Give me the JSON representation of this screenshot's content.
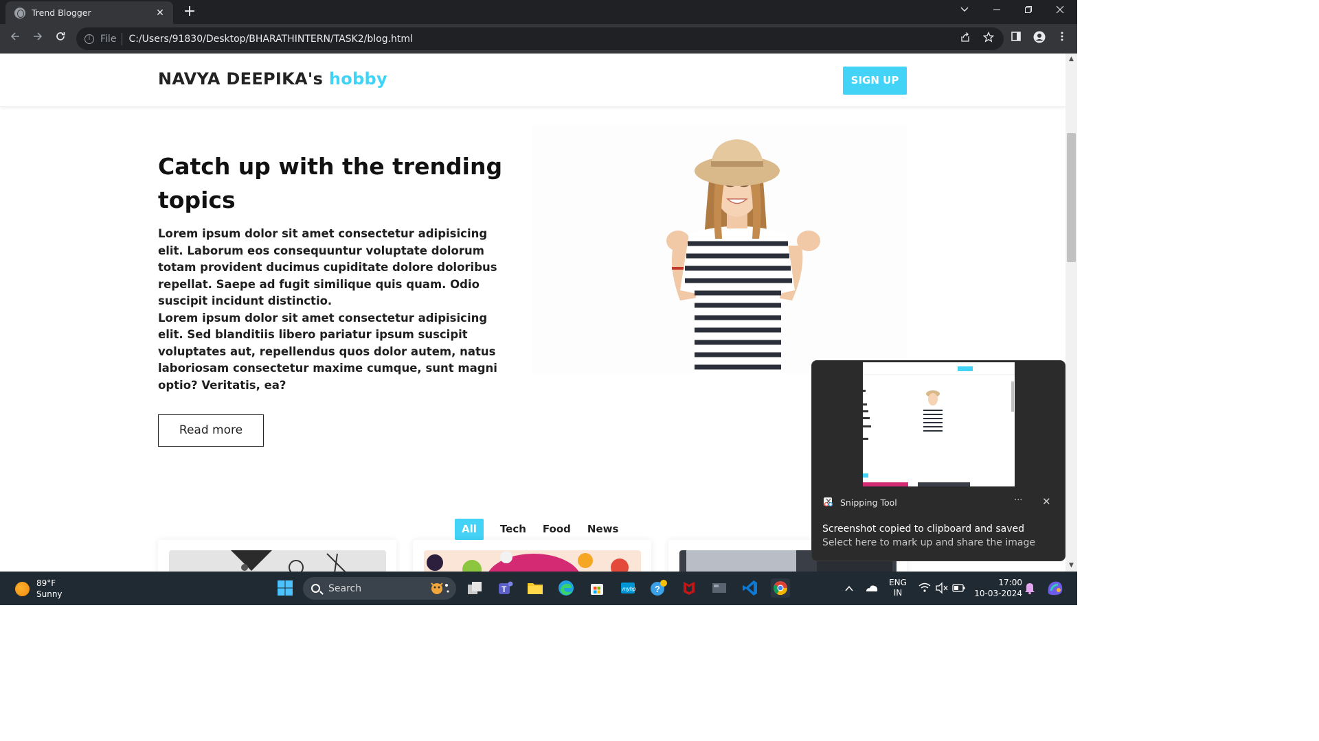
{
  "browser": {
    "tab_title": "Trend Blogger",
    "tab_close": "✕",
    "new_tab": "+",
    "file_label": "File",
    "url": "C:/Users/91830/Desktop/BHARATHINTERN/TASK2/blog.html"
  },
  "site": {
    "brand_name": "NAVYA DEEPIKA's",
    "brand_accent": "hobby",
    "signup_label": "SIGN UP",
    "accent_color": "#42d3f6"
  },
  "hero": {
    "title": "Catch up with the trending topics",
    "paragraph": "Lorem ipsum dolor sit amet consectetur adipisicing elit. Laborum eos consequuntur voluptate dolorum totam provident ducimus cupiditate dolore doloribus repellat. Saepe ad fugit similique quis quam. Odio suscipit incidunt distinctio.",
    "paragraph2": "Lorem ipsum dolor sit amet consectetur adipisicing elit. Sed blanditiis libero pariatur ipsum suscipit voluptates aut, repellendus quos dolor autem, natus laboriosam consectetur maxime cumque, sunt magni optio? Veritatis, ea?",
    "read_more": "Read more"
  },
  "filters": [
    "All",
    "Tech",
    "Food",
    "News"
  ],
  "toast": {
    "app_name": "Snipping Tool",
    "more": "···",
    "close": "✕",
    "message": "Screenshot copied to clipboard and saved",
    "sub_message": "Select here to mark up and share the image"
  },
  "taskbar": {
    "temperature": "89°F",
    "condition": "Sunny",
    "search_placeholder": "Search",
    "language": "ENG",
    "region": "IN",
    "time": "17:00",
    "date": "10-03-2024"
  }
}
